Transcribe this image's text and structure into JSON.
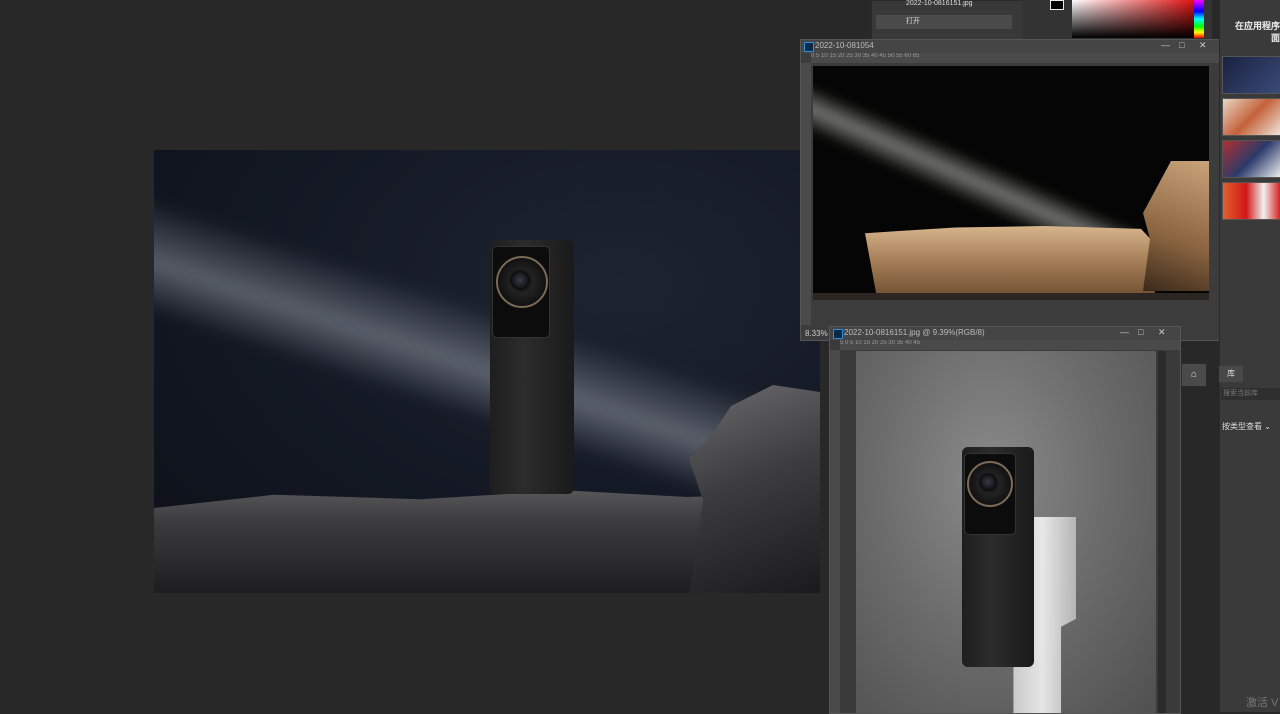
{
  "history": {
    "snapshot_label": "2022-10-0816151.jpg",
    "open_label": "打开"
  },
  "doc1": {
    "title": "2022-10-081054",
    "zoom": "8.33%",
    "ruler_marks": "0   5   10   15   20   25   30   35   40   45   50   55   60   65"
  },
  "doc2": {
    "title": "2022-10-0816151.jpg @ 9.39%(RGB/8)",
    "ruler_marks": "5   0   5   10   15   20   25   30   35   40   45"
  },
  "dock": {
    "hint": "在应用程序\n面"
  },
  "library": {
    "tab": "库",
    "search_placeholder": "搜索当前库",
    "view_by": "按类型查看 ⌄"
  },
  "system": {
    "activate": "激活 V"
  },
  "window_controls": {
    "min": "—",
    "max": "□",
    "close": "✕"
  },
  "icons": {
    "lock": "⌂",
    "new_snapshot": "⎘",
    "camera": "📷",
    "trash": "🗑"
  }
}
